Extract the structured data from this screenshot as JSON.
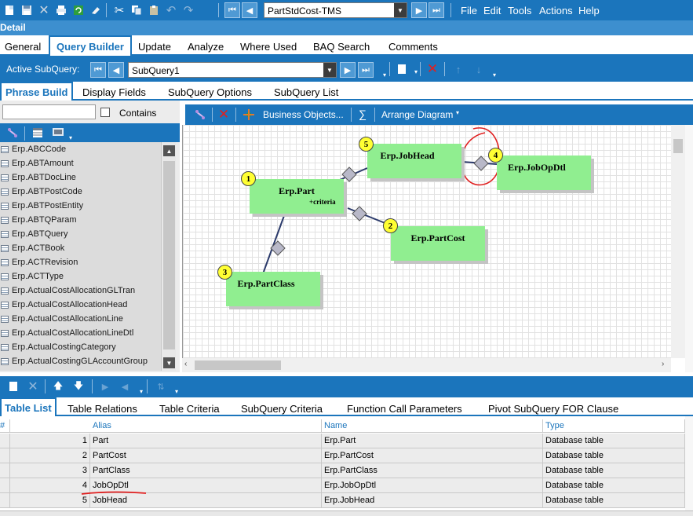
{
  "toolbar": {
    "record_value": "PartStdCost-TMS",
    "menu": [
      "File",
      "Edit",
      "Tools",
      "Actions",
      "Help"
    ]
  },
  "detail_label": "Detail",
  "main_tabs": [
    "General",
    "Query Builder",
    "Update",
    "Analyze",
    "Where Used",
    "BAQ Search",
    "Comments"
  ],
  "main_tab_active": "Query Builder",
  "subquery": {
    "label": "Active SubQuery:",
    "value": "SubQuery1"
  },
  "phrase_tabs": [
    "Phrase Build",
    "Display Fields",
    "SubQuery Options",
    "SubQuery List"
  ],
  "phrase_tab_active": "Phrase Build",
  "table_search": {
    "value": "",
    "contains_label": "Contains",
    "contains_checked": false
  },
  "tables": [
    "Erp.ABCCode",
    "Erp.ABTAmount",
    "Erp.ABTDocLine",
    "Erp.ABTPostCode",
    "Erp.ABTPostEntity",
    "Erp.ABTQParam",
    "Erp.ABTQuery",
    "Erp.ACTBook",
    "Erp.ACTRevision",
    "Erp.ACTType",
    "Erp.ActualCostAllocationGLTran",
    "Erp.ActualCostAllocationHead",
    "Erp.ActualCostAllocationLine",
    "Erp.ActualCostAllocationLineDtl",
    "Erp.ActualCostingCategory",
    "Erp.ActualCostingGLAccountGroup"
  ],
  "diagram_toolbar": {
    "business_objects": "Business Objects...",
    "sigma": "∑",
    "arrange": "Arrange Diagram"
  },
  "diagram": {
    "nodes": [
      {
        "num": "1",
        "name": "Erp.Part",
        "sub": "+criteria"
      },
      {
        "num": "2",
        "name": "Erp.PartCost",
        "sub": ""
      },
      {
        "num": "3",
        "name": "Erp.PartClass",
        "sub": ""
      },
      {
        "num": "4",
        "name": "Erp.JobOpDtl",
        "sub": ""
      },
      {
        "num": "5",
        "name": "Erp.JobHead",
        "sub": ""
      }
    ]
  },
  "bottom_tabs": [
    "Table List",
    "Table Relations",
    "Table Criteria",
    "SubQuery Criteria",
    "Function Call Parameters",
    "Pivot SubQuery FOR Clause"
  ],
  "bottom_tab_active": "Table List",
  "grid": {
    "columns": [
      "#",
      "Alias",
      "Name",
      "Type"
    ],
    "rows": [
      {
        "num": "1",
        "alias": "Part",
        "name": "Erp.Part",
        "type": "Database table"
      },
      {
        "num": "2",
        "alias": "PartCost",
        "name": "Erp.PartCost",
        "type": "Database table"
      },
      {
        "num": "3",
        "alias": "PartClass",
        "name": "Erp.PartClass",
        "type": "Database table"
      },
      {
        "num": "4",
        "alias": "JobOpDtl",
        "name": "Erp.JobOpDtl",
        "type": "Database table"
      },
      {
        "num": "5",
        "alias": "JobHead",
        "name": "Erp.JobHead",
        "type": "Database table"
      }
    ]
  },
  "colors": {
    "accent": "#1b75bc",
    "node_fill": "#90ee90",
    "badge": "#ffff33",
    "annotation": "#e02020"
  }
}
